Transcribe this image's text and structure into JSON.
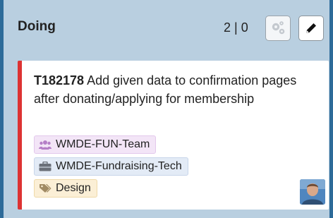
{
  "column": {
    "title": "Doing",
    "count": "2 | 0"
  },
  "header_buttons": {
    "gear_icon": "gear-icon",
    "edit_icon": "pencil-icon"
  },
  "card": {
    "task_id": "T182178",
    "title_text": "Add given data to confirmation pages after donating/applying for membership",
    "accent_color": "#dd3333",
    "tags": [
      {
        "icon": "users-icon",
        "label": "WMDE-FUN-Team",
        "color": "#b57fc7"
      },
      {
        "icon": "briefcase-icon",
        "label": "WMDE-Fundraising-Tech",
        "color": "#6a6f78"
      },
      {
        "icon": "tag-icon",
        "label": "Design",
        "color": "#a08a63"
      }
    ],
    "avatar": "user-avatar"
  }
}
